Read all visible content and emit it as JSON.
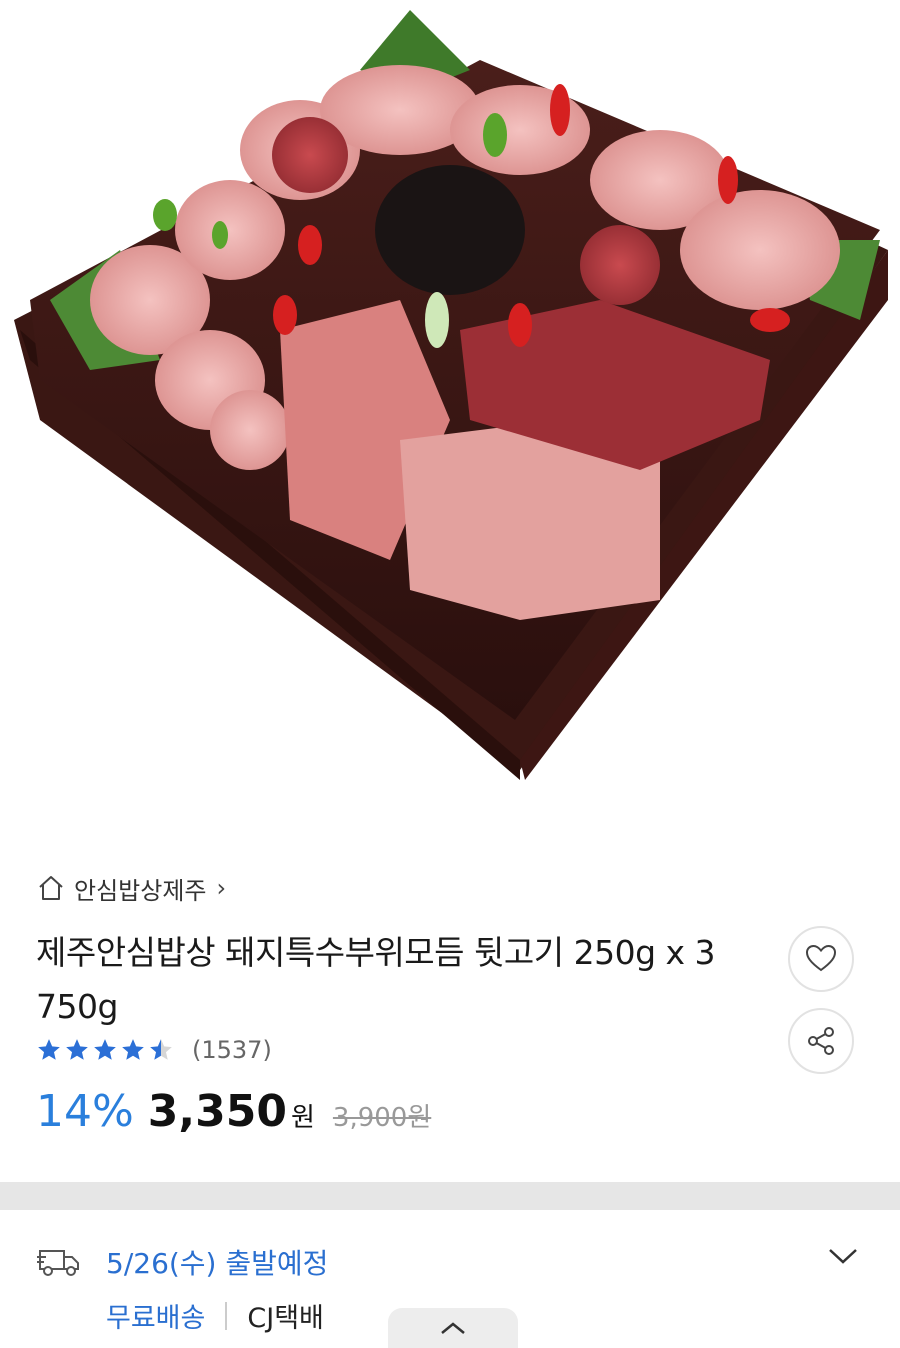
{
  "product": {
    "image_alt": "돼지특수부위모듬 접시",
    "store_name": "안심밥상제주",
    "title": "제주안심밥상 돼지특수부위모듬 뒷고기 250g x 3 750g",
    "rating": 4.5,
    "review_count": "(1537)",
    "discount": "14%",
    "price": "3,350",
    "currency": "원",
    "original_price": "3,900원"
  },
  "delivery": {
    "date_text": "5/26(수) 출발예정",
    "free_shipping": "무료배송",
    "courier": "CJ택배"
  },
  "icons": {
    "store": "home-icon",
    "wish": "heart-icon",
    "share": "share-icon",
    "truck": "truck-icon",
    "expand": "chevron-down-icon",
    "handle": "chevron-up-icon"
  },
  "colors": {
    "accent": "#2a7fdc",
    "star": "#2b6fd6",
    "divider": "#e6e6e6"
  }
}
